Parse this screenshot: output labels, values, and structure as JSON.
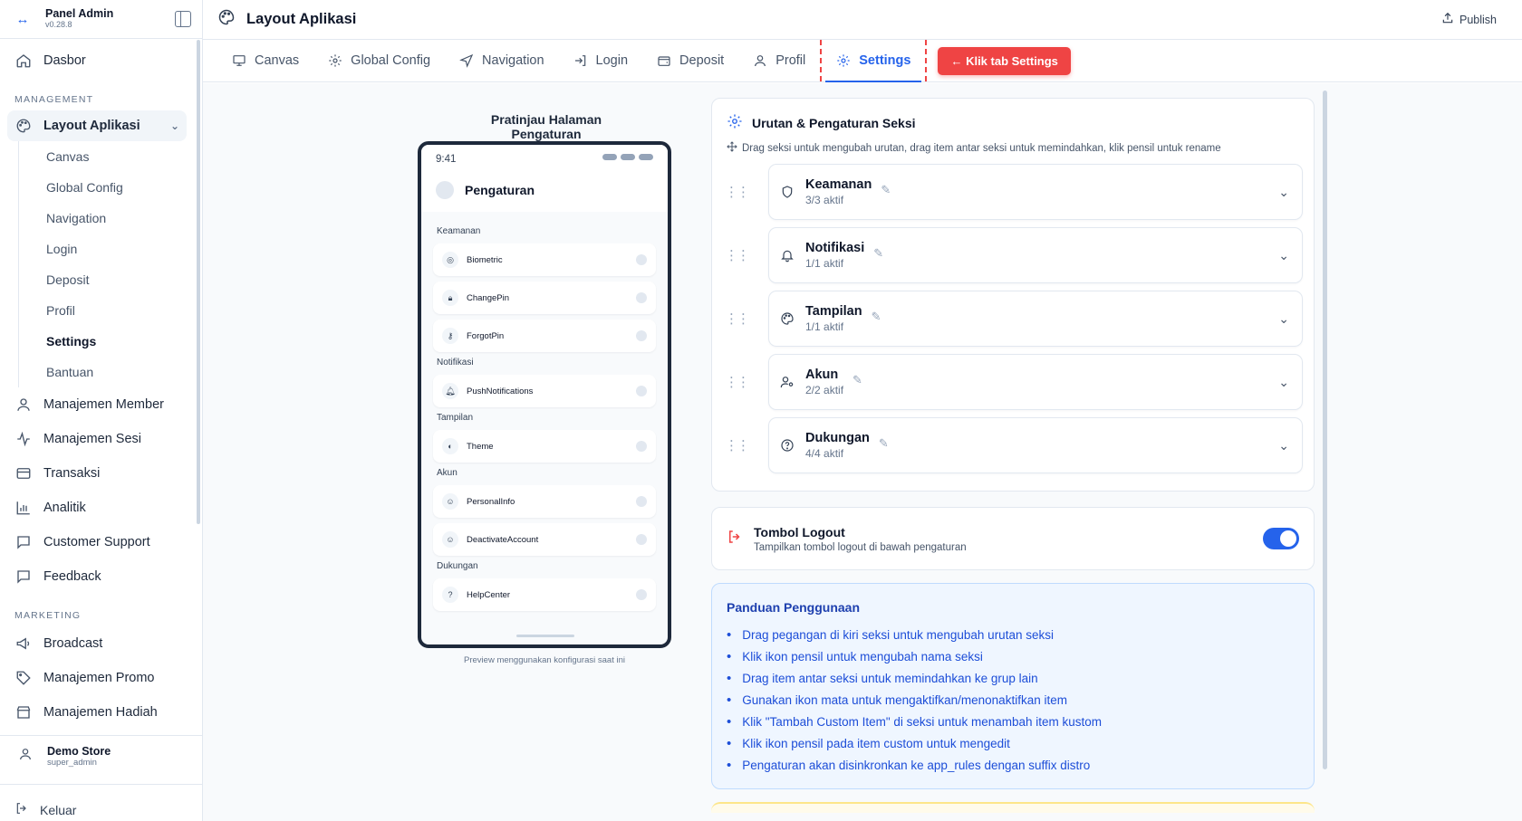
{
  "brand": {
    "title": "Panel Admin",
    "version": "v0.28.8"
  },
  "sidebar": {
    "top": {
      "label": "Dasbor"
    },
    "management_label": "MANAGEMENT",
    "layout": {
      "label": "Layout Aplikasi"
    },
    "sub_items": [
      "Canvas",
      "Global Config",
      "Navigation",
      "Login",
      "Deposit",
      "Profil",
      "Settings",
      "Bantuan"
    ],
    "items": [
      "Manajemen Member",
      "Manajemen Sesi",
      "Transaksi",
      "Analitik",
      "Customer Support",
      "Feedback"
    ],
    "marketing_label": "MARKETING",
    "marketing_items": [
      "Broadcast",
      "Manajemen Promo",
      "Manajemen Hadiah"
    ]
  },
  "user": {
    "name": "Demo Store",
    "role": "super_admin"
  },
  "logout_label": "Keluar",
  "header": {
    "title": "Layout Aplikasi",
    "publish": "Publish"
  },
  "tabs": [
    "Canvas",
    "Global Config",
    "Navigation",
    "Login",
    "Deposit",
    "Profil",
    "Settings"
  ],
  "callout": "← Klik tab Settings",
  "preview": {
    "title": "Pratinjau Halaman Pengaturan",
    "time": "9:41",
    "page_title": "Pengaturan",
    "groups": [
      {
        "label": "Keamanan",
        "items": [
          "Biometric",
          "ChangePin",
          "ForgotPin"
        ]
      },
      {
        "label": "Notifikasi",
        "items": [
          "PushNotifications"
        ]
      },
      {
        "label": "Tampilan",
        "items": [
          "Theme"
        ]
      },
      {
        "label": "Akun",
        "items": [
          "PersonalInfo",
          "DeactivateAccount"
        ]
      },
      {
        "label": "Dukungan",
        "items": [
          "HelpCenter"
        ]
      }
    ],
    "note": "Preview menggunakan konfigurasi saat ini"
  },
  "sections_card": {
    "title": "Urutan & Pengaturan Seksi",
    "hint": "Drag seksi untuk mengubah urutan, drag item antar seksi untuk memindahkan, klik pensil untuk rename",
    "sections": [
      {
        "name": "Keamanan",
        "count": "3/3 aktif",
        "icon": "shield-icon"
      },
      {
        "name": "Notifikasi",
        "count": "1/1 aktif",
        "icon": "bell-icon"
      },
      {
        "name": "Tampilan",
        "count": "1/1 aktif",
        "icon": "palette-icon"
      },
      {
        "name": "Akun",
        "count": "2/2 aktif",
        "icon": "user-gear-icon"
      },
      {
        "name": "Dukungan",
        "count": "4/4 aktif",
        "icon": "help-circle-icon"
      }
    ]
  },
  "logout_card": {
    "title": "Tombol Logout",
    "subtitle": "Tampilkan tombol logout di bawah pengaturan",
    "enabled": true
  },
  "guide": {
    "title": "Panduan Penggunaan",
    "items": [
      "Drag pegangan di kiri seksi untuk mengubah urutan seksi",
      "Klik ikon pensil untuk mengubah nama seksi",
      "Drag item antar seksi untuk memindahkan ke grup lain",
      "Gunakan ikon mata untuk mengaktifkan/menonaktifkan item",
      "Klik \"Tambah Custom Item\" di seksi untuk menambah item kustom",
      "Klik ikon pensil pada item custom untuk mengedit",
      "Pengaturan akan disinkronkan ke app_rules dengan suffix distro"
    ]
  },
  "colors": {
    "accent": "#2563eb",
    "danger": "#ef4444"
  }
}
